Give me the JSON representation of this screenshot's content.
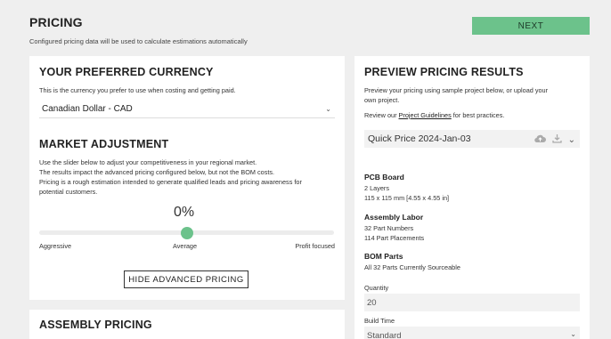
{
  "header": {
    "title": "PRICING",
    "subtitle": "Configured pricing data will be used to calculate estimations automatically",
    "next_label": "NEXT"
  },
  "currency": {
    "heading": "YOUR PREFERRED CURRENCY",
    "description": "This is the currency you prefer to use when costing and getting paid.",
    "selected": "Canadian Dollar - CAD"
  },
  "market": {
    "heading": "MARKET ADJUSTMENT",
    "desc_line1": "Use the slider below to adjust your competitiveness in your regional market.",
    "desc_line2": "The results impact the advanced pricing configured below, but not the BOM costs.",
    "desc_line3": "Pricing is a rough estimation intended to generate qualified leads and pricing awareness for",
    "desc_line4": "potential customers.",
    "percent": "0%",
    "slider_value": 0.5,
    "label_left": "Aggressive",
    "label_mid": "Average",
    "label_right": "Profit focused",
    "hide_label": "HIDE ADVANCED PRICING"
  },
  "assembly": {
    "heading": "ASSEMBLY PRICING"
  },
  "preview": {
    "heading": "PREVIEW PRICING RESULTS",
    "desc_line1": "Preview your pricing using sample project below, or upload your",
    "desc_line2": "own project.",
    "review_prefix": "Review our ",
    "review_link": "Project Guidelines",
    "review_suffix": " for best practices.",
    "sample_selected": "Quick Price 2024-Jan-03",
    "pcb_title": "PCB Board",
    "pcb_line1": "2 Layers",
    "pcb_line2": "115 x 115 mm [4.55 x 4.55 in]",
    "labor_title": "Assembly Labor",
    "labor_line1": "32 Part Numbers",
    "labor_line2": "114 Part Placements",
    "bom_title": "BOM Parts",
    "bom_line1": "All 32 Parts Currently Sourceable",
    "quantity_label": "Quantity",
    "quantity_value": "20",
    "build_time_label": "Build Time",
    "build_time_value": "Standard"
  },
  "colors": {
    "accent": "#6cc28b",
    "background": "#efefef"
  }
}
